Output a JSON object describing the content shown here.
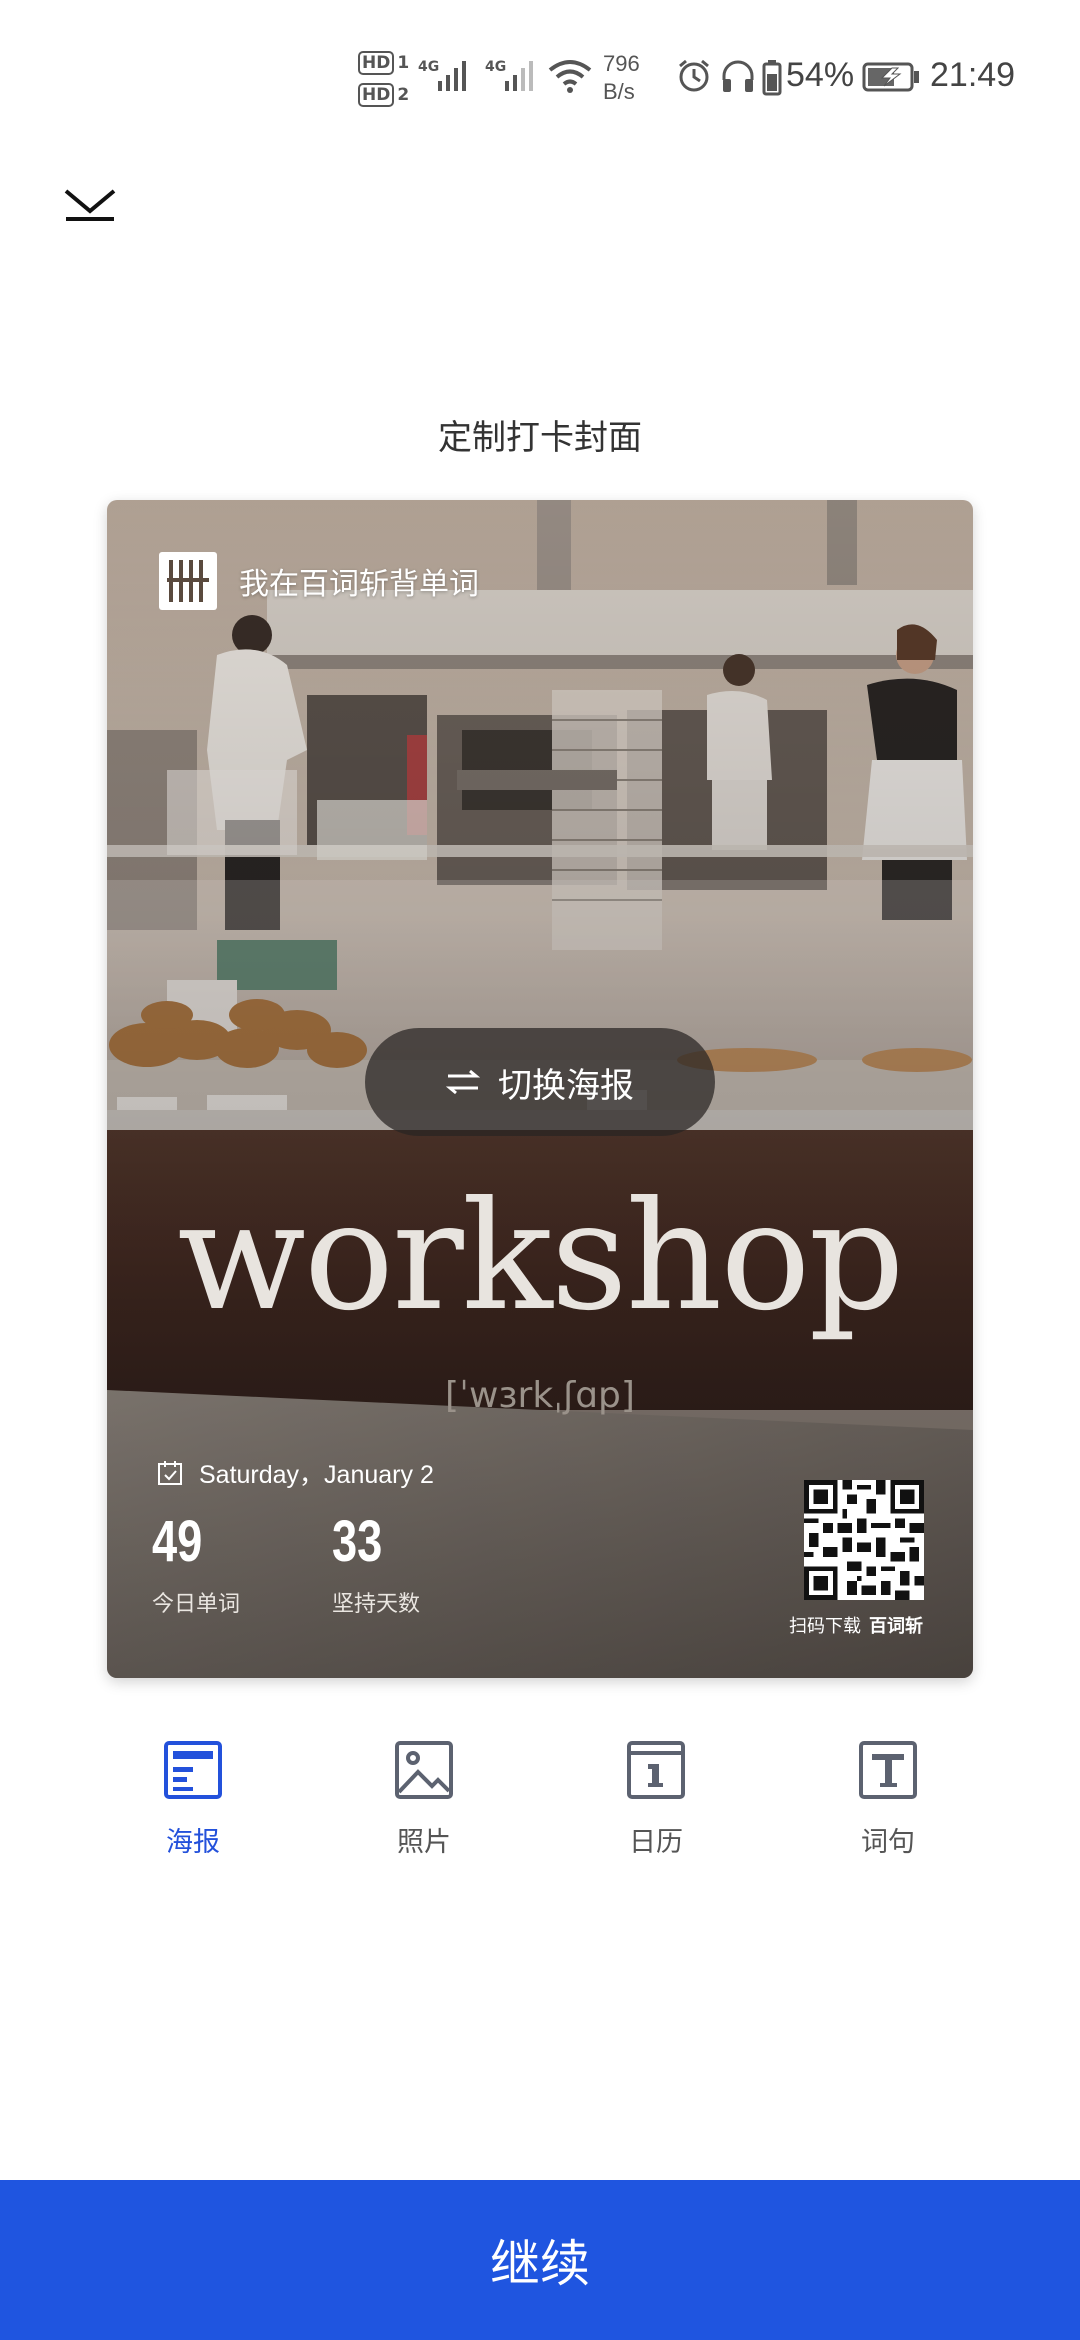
{
  "status_bar": {
    "hd1": "HD",
    "hd2": "HD",
    "hd1_sub": "1",
    "hd2_sub": "2",
    "net1": "4G",
    "net2": "4G",
    "speed_value": "796",
    "speed_unit": "B/s",
    "battery_percent": "54%",
    "time": "21:49"
  },
  "header": {
    "close_icon": "chevron-down-icon",
    "title": "定制打卡封面"
  },
  "poster": {
    "brand_text": "我在百词斩背单词",
    "switch_label": "切换海报",
    "word": "workshop",
    "phonetic": "[ˈwɜrkˌʃɑp]",
    "date": "Saturday，January 2",
    "stats": [
      {
        "value": "49",
        "label": "今日单词"
      },
      {
        "value": "33",
        "label": "坚持天数"
      }
    ],
    "qr_caption": "扫码下载",
    "qr_brand": "百词斩"
  },
  "tabs": [
    {
      "label": "海报",
      "icon": "poster-icon",
      "active": true
    },
    {
      "label": "照片",
      "icon": "photo-icon",
      "active": false
    },
    {
      "label": "日历",
      "icon": "calendar-icon",
      "active": false
    },
    {
      "label": "词句",
      "icon": "text-icon",
      "active": false
    }
  ],
  "colors": {
    "accent": "#2351db",
    "button": "#1f55e0"
  },
  "continue_label": "继续"
}
